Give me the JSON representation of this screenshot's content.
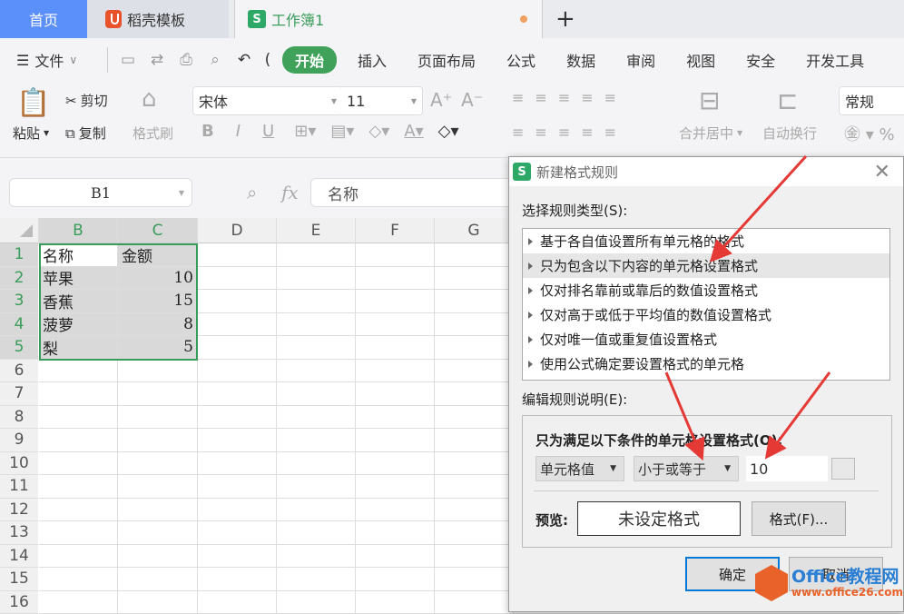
{
  "tabs": [
    {
      "label": "首页",
      "active": false
    },
    {
      "label": "稻壳模板",
      "icon": "docer-icon"
    },
    {
      "label": "工作簿1",
      "icon": "spreadsheet-icon",
      "active": true,
      "unsaved": true
    }
  ],
  "new_tab_label": "+",
  "menu": {
    "file_label": "文件",
    "items": [
      "开始",
      "插入",
      "页面布局",
      "公式",
      "数据",
      "审阅",
      "视图",
      "安全",
      "开发工具"
    ],
    "active": "开始"
  },
  "ribbon": {
    "paste": "粘贴",
    "cut": "剪切",
    "copy": "复制",
    "format_painter": "格式刷",
    "font_name": "宋体",
    "font_size": "11",
    "merge_center": "合并居中",
    "wrap_text": "自动换行",
    "number_format": "常规"
  },
  "formula_bar": {
    "cell_ref": "B1",
    "fx_label": "fx",
    "content": "名称"
  },
  "sheet": {
    "columns": [
      "B",
      "C",
      "D",
      "E",
      "F",
      "G"
    ],
    "selected_columns": [
      "B",
      "C"
    ],
    "rows": [
      "1",
      "2",
      "3",
      "4",
      "5",
      "6",
      "7",
      "8",
      "9",
      "10",
      "11",
      "12",
      "13",
      "14",
      "15",
      "16"
    ],
    "data": [
      {
        "name": "名称",
        "amount": "金额"
      },
      {
        "name": "苹果",
        "amount": "10"
      },
      {
        "name": "香蕉",
        "amount": "15"
      },
      {
        "name": "菠萝",
        "amount": "8"
      },
      {
        "name": "梨",
        "amount": "5"
      }
    ]
  },
  "dialog": {
    "title": "新建格式规则",
    "select_rule_label": "选择规则类型(S):",
    "rule_types": [
      "基于各自值设置所有单元格的格式",
      "只为包含以下内容的单元格设置格式",
      "仅对排名靠前或靠后的数值设置格式",
      "仅对高于或低于平均值的数值设置格式",
      "仅对唯一值或重复值设置格式",
      "使用公式确定要设置格式的单元格"
    ],
    "selected_rule_index": 1,
    "edit_rule_label": "编辑规则说明(E):",
    "condition_heading": "只为满足以下条件的单元格设置格式(O):",
    "condition_field": "单元格值",
    "condition_operator": "小于或等于",
    "condition_value": "10",
    "preview_label": "预览:",
    "preview_text": "未设定格式",
    "format_button": "格式(F)...",
    "ok_button": "确定",
    "cancel_button": "取消"
  },
  "watermark": {
    "line1": "Office教程网",
    "line2": "www.office26.com"
  },
  "colors": {
    "accent_green": "#40a25a",
    "home_tab_blue": "#5b8ff9",
    "annotation_red": "#e53935"
  }
}
